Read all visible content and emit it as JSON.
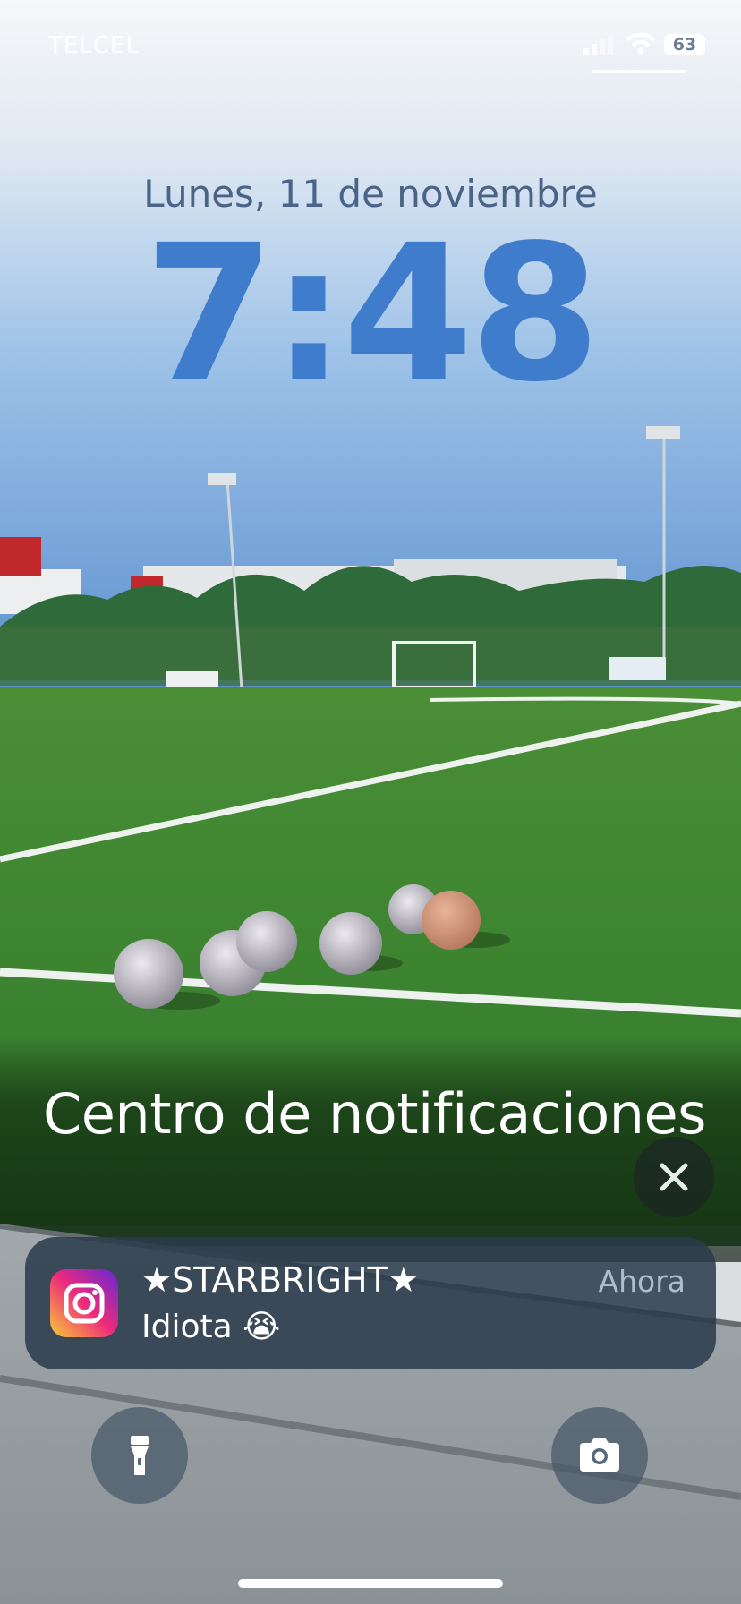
{
  "status_bar": {
    "carrier": "TELCEL",
    "battery": "63"
  },
  "lock_screen": {
    "date": "Lunes, 11 de noviembre",
    "time": "7:48"
  },
  "notification_center": {
    "title": "Centro de notificaciones",
    "close_icon": "close-icon"
  },
  "notification": {
    "app_icon": "instagram-icon",
    "title": "★STARBRIGHT★",
    "body": "Idiota 😭",
    "time": "Ahora"
  },
  "quick_actions": {
    "left_icon": "flashlight-icon",
    "right_icon": "camera-icon"
  },
  "colors": {
    "time": "#3f7ccc",
    "date": "#4b6386",
    "notification_bg": "#2a3a4a",
    "turf": "#3f8a33"
  }
}
